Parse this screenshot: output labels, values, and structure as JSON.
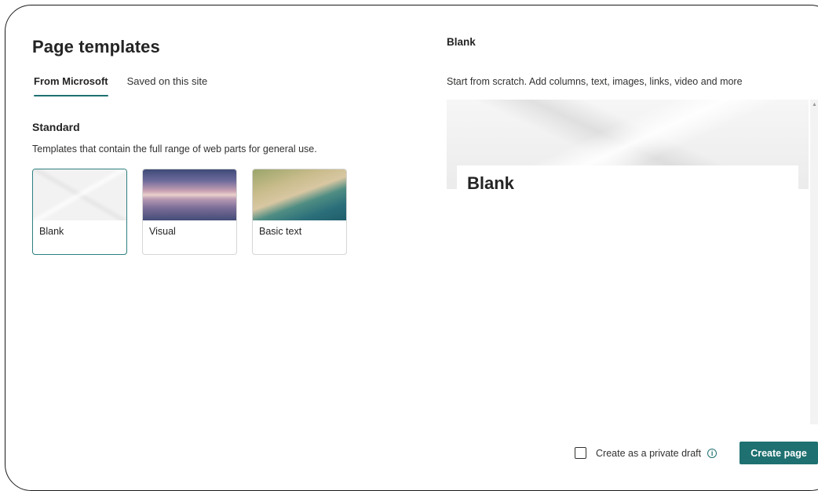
{
  "header": {
    "title": "Page templates"
  },
  "tabs": [
    {
      "label": "From Microsoft",
      "active": true
    },
    {
      "label": "Saved on this site",
      "active": false
    }
  ],
  "section": {
    "heading": "Standard",
    "description": "Templates that contain the full range of web parts for general use."
  },
  "templates": [
    {
      "label": "Blank",
      "selected": true,
      "thumbnail": "white-geometric-pattern"
    },
    {
      "label": "Visual",
      "selected": false,
      "thumbnail": "misty-lake-mountains"
    },
    {
      "label": "Basic text",
      "selected": false,
      "thumbnail": "aerial-beach"
    }
  ],
  "preview": {
    "title": "Blank",
    "description": "Start from scratch. Add columns, text, images, links, video and more",
    "page_title": "Blank"
  },
  "footer": {
    "private_draft_label": "Create as a private draft",
    "private_draft_checked": false,
    "create_button_label": "Create page"
  },
  "colors": {
    "accent": "#1f7070",
    "text": "#242424",
    "border": "#d6d6d6"
  }
}
